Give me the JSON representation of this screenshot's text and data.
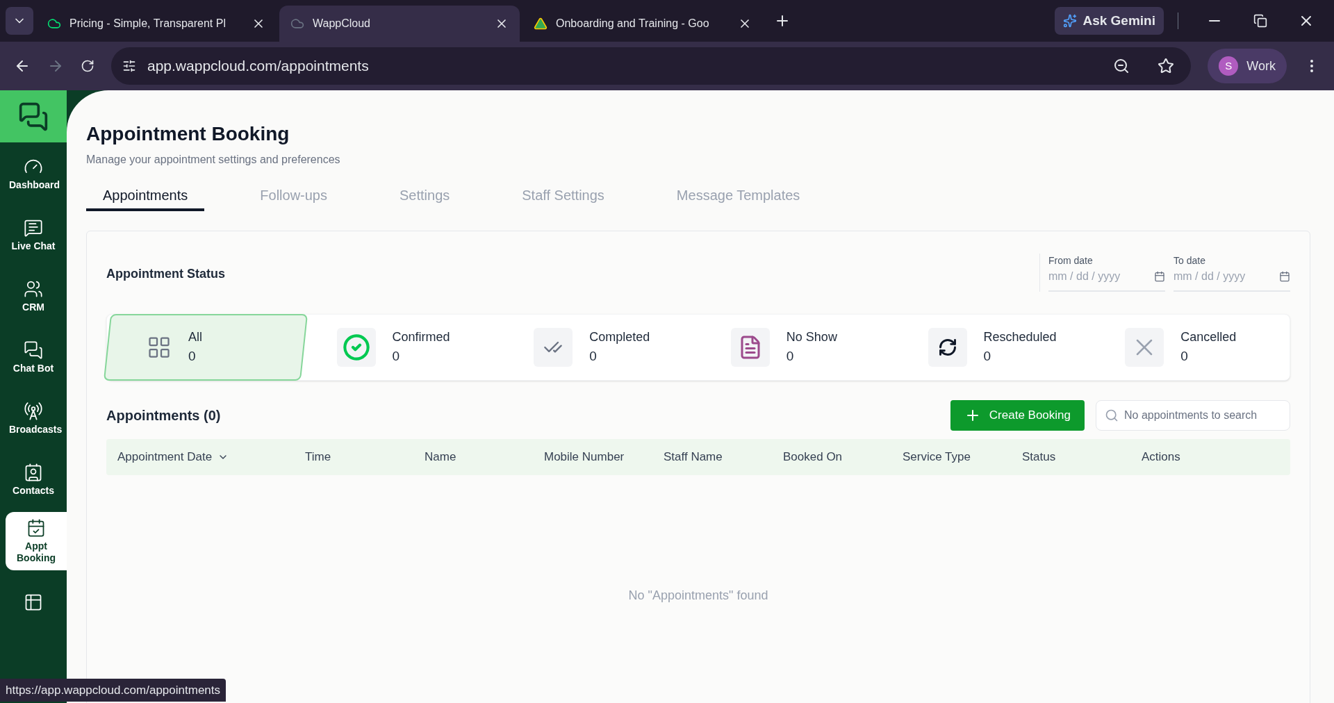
{
  "browser": {
    "tabs": [
      {
        "title": "Pricing - Simple, Transparent Pl",
        "selected": false,
        "kind": "cloud"
      },
      {
        "title": "WappCloud",
        "selected": true,
        "kind": "cloud"
      },
      {
        "title": "Onboarding and Training - Goo",
        "selected": false,
        "kind": "drive"
      }
    ],
    "gemini": "Ask Gemini",
    "url": "app.wappcloud.com/appointments",
    "profile_initial": "S",
    "profile": "Work"
  },
  "sidebar": {
    "items": [
      {
        "label": "Dashboard",
        "kind": "dashboard",
        "selected": false
      },
      {
        "label": "Live Chat",
        "kind": "livechat",
        "selected": false
      },
      {
        "label": "CRM",
        "kind": "crm",
        "selected": false
      },
      {
        "label": "Chat Bot",
        "kind": "chatbot",
        "selected": false
      },
      {
        "label": "Broadcasts",
        "kind": "broadcasts",
        "selected": false
      },
      {
        "label": "Contacts",
        "kind": "contacts",
        "selected": false
      },
      {
        "label": "Appt Booking",
        "kind": "booking",
        "selected": true
      },
      {
        "kind": "grid",
        "selected": false
      }
    ]
  },
  "page": {
    "title": "Appointment Booking",
    "subtitle": "Manage your appointment settings and preferences",
    "tabs": [
      {
        "label": "Appointments",
        "selected": true
      },
      {
        "label": "Follow-ups",
        "selected": false
      },
      {
        "label": "Settings",
        "selected": false
      },
      {
        "label": "Staff Settings",
        "selected": false
      },
      {
        "label": "Message Templates",
        "selected": false
      }
    ]
  },
  "status": {
    "title": "Appointment Status",
    "dates": [
      {
        "label": "From date",
        "placeholder": "mm / dd / yyyy"
      },
      {
        "label": "To date",
        "placeholder": "mm / dd / yyyy"
      }
    ],
    "cards": [
      {
        "label": "All",
        "count": "0",
        "kind": "all",
        "selected": true
      },
      {
        "label": "Confirmed",
        "count": "0",
        "kind": "confirmed",
        "selected": false
      },
      {
        "label": "Completed",
        "count": "0",
        "kind": "completed",
        "selected": false
      },
      {
        "label": "No Show",
        "count": "0",
        "kind": "no_show",
        "selected": false
      },
      {
        "label": "Rescheduled",
        "count": "0",
        "kind": "rescheduled",
        "selected": false
      },
      {
        "label": "Cancelled",
        "count": "0",
        "kind": "cancelled",
        "selected": false
      }
    ]
  },
  "appointments": {
    "title": "Appointments (0)",
    "create_button": "Create Booking",
    "search_placeholder": "No appointments to search",
    "columns": [
      "Appointment Date",
      "Time",
      "Name",
      "Mobile Number",
      "Staff Name",
      "Booked On",
      "Service Type",
      "Status",
      "Actions"
    ],
    "empty_message": "No \"Appointments\" found"
  },
  "status_bar": "https://app.wappcloud.com/appointments"
}
